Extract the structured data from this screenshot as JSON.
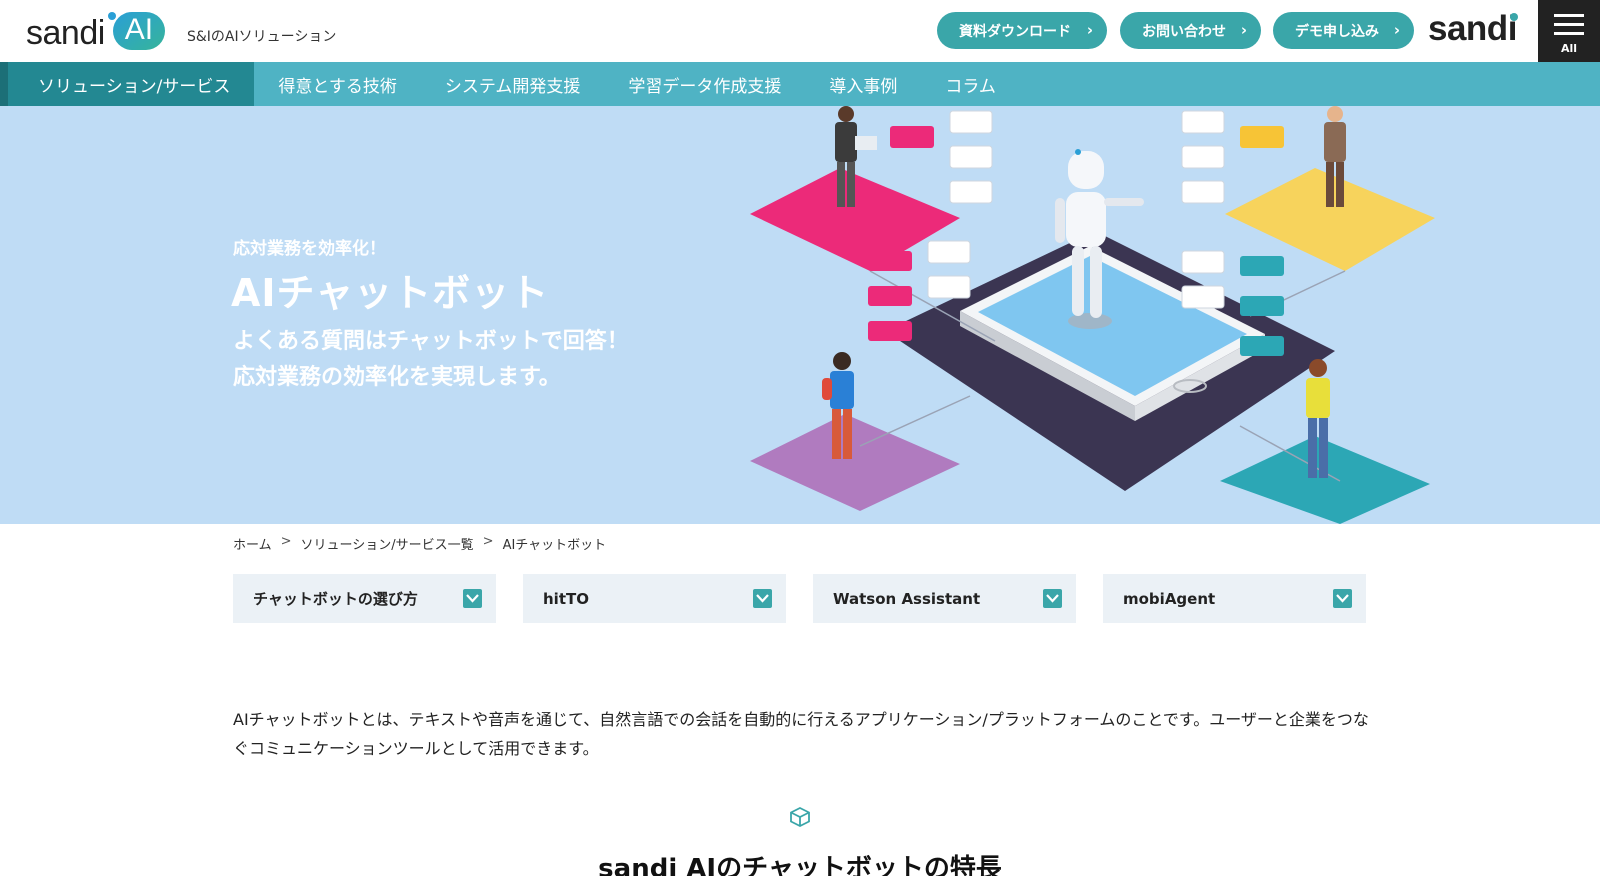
{
  "header": {
    "logo_text": "sandi",
    "logo_ai": "AI",
    "tagline": "S&IのAIソリューション",
    "buttons": [
      {
        "label": "資料ダウンロード"
      },
      {
        "label": "お問い合わせ"
      },
      {
        "label": "デモ申し込み"
      }
    ],
    "brand_right": "sandi",
    "menu_label": "All"
  },
  "nav": {
    "items": [
      {
        "label": "ソリューション/サービス",
        "active": true
      },
      {
        "label": "得意とする技術"
      },
      {
        "label": "システム開発支援"
      },
      {
        "label": "学習データ作成支援"
      },
      {
        "label": "導入事例"
      },
      {
        "label": "コラム"
      }
    ]
  },
  "hero": {
    "eyebrow": "応対業務を効率化！",
    "title": "AIチャットボット",
    "desc_line1": "よくある質問はチャットボットで回答！",
    "desc_line2": "応対業務の効率化を実現します。"
  },
  "breadcrumb": {
    "items": [
      "ホーム",
      "ソリューション/サービス一覧",
      "AIチャットボット"
    ],
    "separator": ">"
  },
  "dropdowns": [
    {
      "label": "チャットボットの選び方"
    },
    {
      "label": "hitTO"
    },
    {
      "label": "Watson Assistant"
    },
    {
      "label": "mobiAgent"
    }
  ],
  "intro": {
    "text": "AIチャットボットとは、テキストや音声を通じて、自然言語での会話を自動的に行えるアプリケーション/プラットフォームのことです。ユーザーと企業をつなぐコミュニケーションツールとして活用できます。"
  },
  "section": {
    "title": "sandi AIのチャットボットの特長"
  },
  "colors": {
    "accent": "#3aa6a9",
    "nav": "#4fb3c4",
    "nav_active": "#238892",
    "hero_bg": "#bfdcf5",
    "dropdown_bg": "#ebf1f6"
  }
}
